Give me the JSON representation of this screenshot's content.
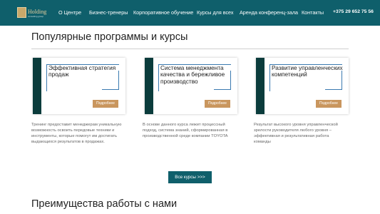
{
  "header": {
    "logo_text": "Holding",
    "logo_subtext": "consulting group",
    "nav": [
      "О Центре",
      "Бизнес-тренеры",
      "Корпоративное обучение",
      "Курсы для всех",
      "Аренда конференц-зала",
      "Контакты"
    ],
    "phone": "+375 29 652 75 56"
  },
  "section1": {
    "title": "Популярные программы и курсы",
    "cards": [
      {
        "title": "Эффективная стратегия продаж",
        "button": "Подробнее",
        "description": "Тренинг предоставит менеджерам уникальную возможность освоить передовые техники и инструменты, которые помогут им достигать выдающихся результатов в продажах."
      },
      {
        "title": "Система менеджмента качества и бережливое производство",
        "button": "Подробнее",
        "description": "В основе данного курса лежит процессный подход, система знаний, сформированная в производственной среде компании TOYOTA"
      },
      {
        "title": "Развитие управленческих компетенций",
        "button": "Подробнее",
        "description": "Результат высокого уровня управленческой зрелости руководителя любого уровня – эффективная и результативная работа команды"
      }
    ],
    "all_courses_button": "Все курсы >>>"
  },
  "section2": {
    "title": "Преимущества работы с нами"
  },
  "colors": {
    "header_bg": "#0f5f6b",
    "accent_gold": "#c9965e",
    "card_bar": "#0b3c3c"
  }
}
